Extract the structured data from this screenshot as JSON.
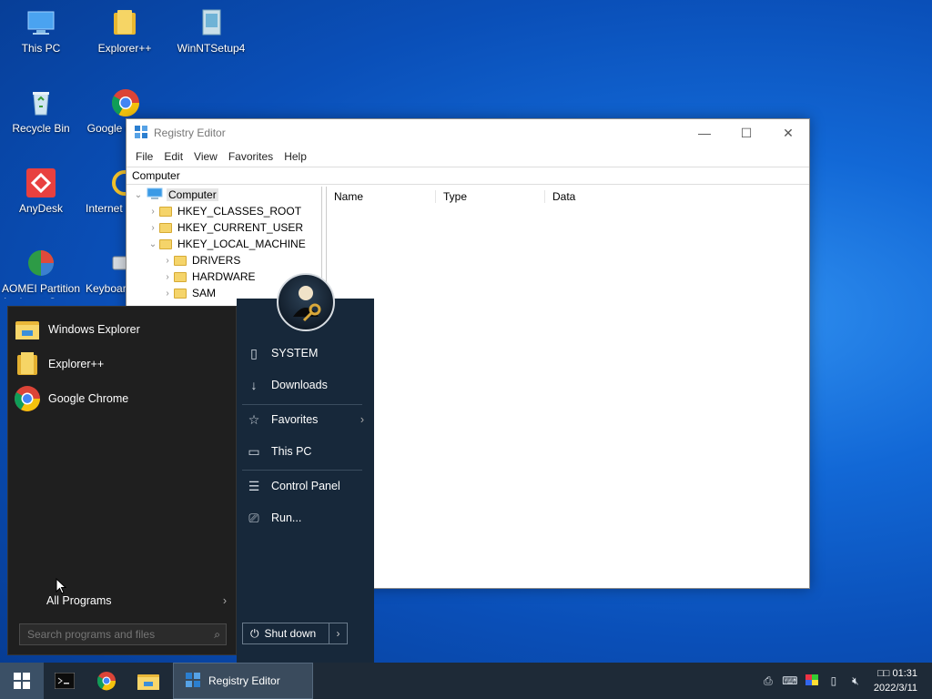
{
  "desktop": {
    "icons": [
      {
        "label": "This PC"
      },
      {
        "label": "Explorer++"
      },
      {
        "label": "WinNTSetup4"
      },
      {
        "label": "Recycle Bin"
      },
      {
        "label": "Google Chrome"
      },
      {
        "label": "AnyDesk"
      },
      {
        "label": "Internet Explorer"
      },
      {
        "label": "AOMEI Partition Assistant Stan..."
      },
      {
        "label": "Keyboard"
      }
    ]
  },
  "regedit": {
    "title": "Registry Editor",
    "menu": [
      "File",
      "Edit",
      "View",
      "Favorites",
      "Help"
    ],
    "address": "Computer",
    "tree": [
      {
        "label": "Computer"
      },
      {
        "label": "HKEY_CLASSES_ROOT"
      },
      {
        "label": "HKEY_CURRENT_USER"
      },
      {
        "label": "HKEY_LOCAL_MACHINE"
      },
      {
        "label": "DRIVERS"
      },
      {
        "label": "HARDWARE"
      },
      {
        "label": "SAM"
      }
    ],
    "columns": [
      "Name",
      "Type",
      "Data"
    ]
  },
  "startmenu": {
    "programs": [
      {
        "label": "Windows Explorer"
      },
      {
        "label": "Explorer++"
      },
      {
        "label": "Google Chrome"
      }
    ],
    "all_programs": "All Programs",
    "search_placeholder": "Search programs and files",
    "right_items": [
      {
        "label": "SYSTEM",
        "icon": "folder-icon"
      },
      {
        "label": "Downloads",
        "icon": "download-icon"
      },
      {
        "label": "Favorites",
        "icon": "star-icon"
      },
      {
        "label": "This PC",
        "icon": "monitor-icon"
      },
      {
        "label": "Control Panel",
        "icon": "control-panel-icon"
      },
      {
        "label": "Run...",
        "icon": "run-icon"
      }
    ],
    "shutdown": "Shut down"
  },
  "taskbar": {
    "active_task": "Registry Editor",
    "time": "01:31",
    "time_prefix": "□□",
    "date": "2022/3/11"
  }
}
